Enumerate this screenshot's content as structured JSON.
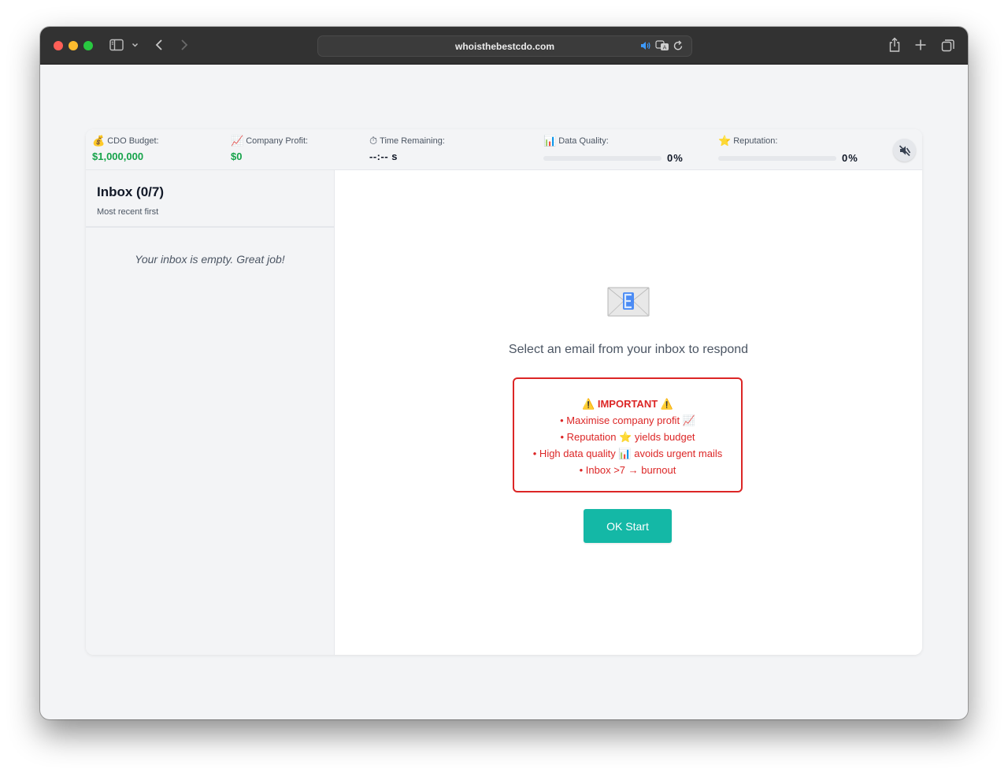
{
  "browser": {
    "url": "whoisthebestcdo.com"
  },
  "stats": {
    "budget": {
      "icon": "💰",
      "label": "CDO Budget:",
      "value": "$1,000,000"
    },
    "profit": {
      "icon": "📈",
      "label": "Company Profit:",
      "value": "$0"
    },
    "time": {
      "icon": "⏱",
      "label": "Time Remaining:",
      "value": "--:-- s"
    },
    "quality": {
      "icon": "📊",
      "label": "Data Quality:",
      "percent_text": "0%",
      "fraction": 0
    },
    "reputation": {
      "icon": "⭐",
      "label": "Reputation:",
      "percent_text": "0%",
      "fraction": 0
    }
  },
  "inbox": {
    "title": "Inbox (0/7)",
    "subtitle": "Most recent first",
    "empty_message": "Your inbox is empty. Great job!"
  },
  "main": {
    "prompt": "Select an email from your inbox to respond",
    "notice": {
      "title": "IMPORTANT",
      "warning_icon": "⚠️",
      "lines": [
        {
          "text": "• Maximise company profit",
          "icon": "📈"
        },
        {
          "text": "• Reputation",
          "icon": "⭐",
          "tail": "yields budget"
        },
        {
          "text": "• High data quality",
          "icon": "📊",
          "tail": "avoids urgent mails"
        },
        {
          "text": "• Inbox >7 → burnout"
        }
      ]
    },
    "start_button": "OK Start"
  },
  "colors": {
    "accent": "#14b8a6",
    "money": "#16a34a",
    "warning": "#dc2626"
  }
}
